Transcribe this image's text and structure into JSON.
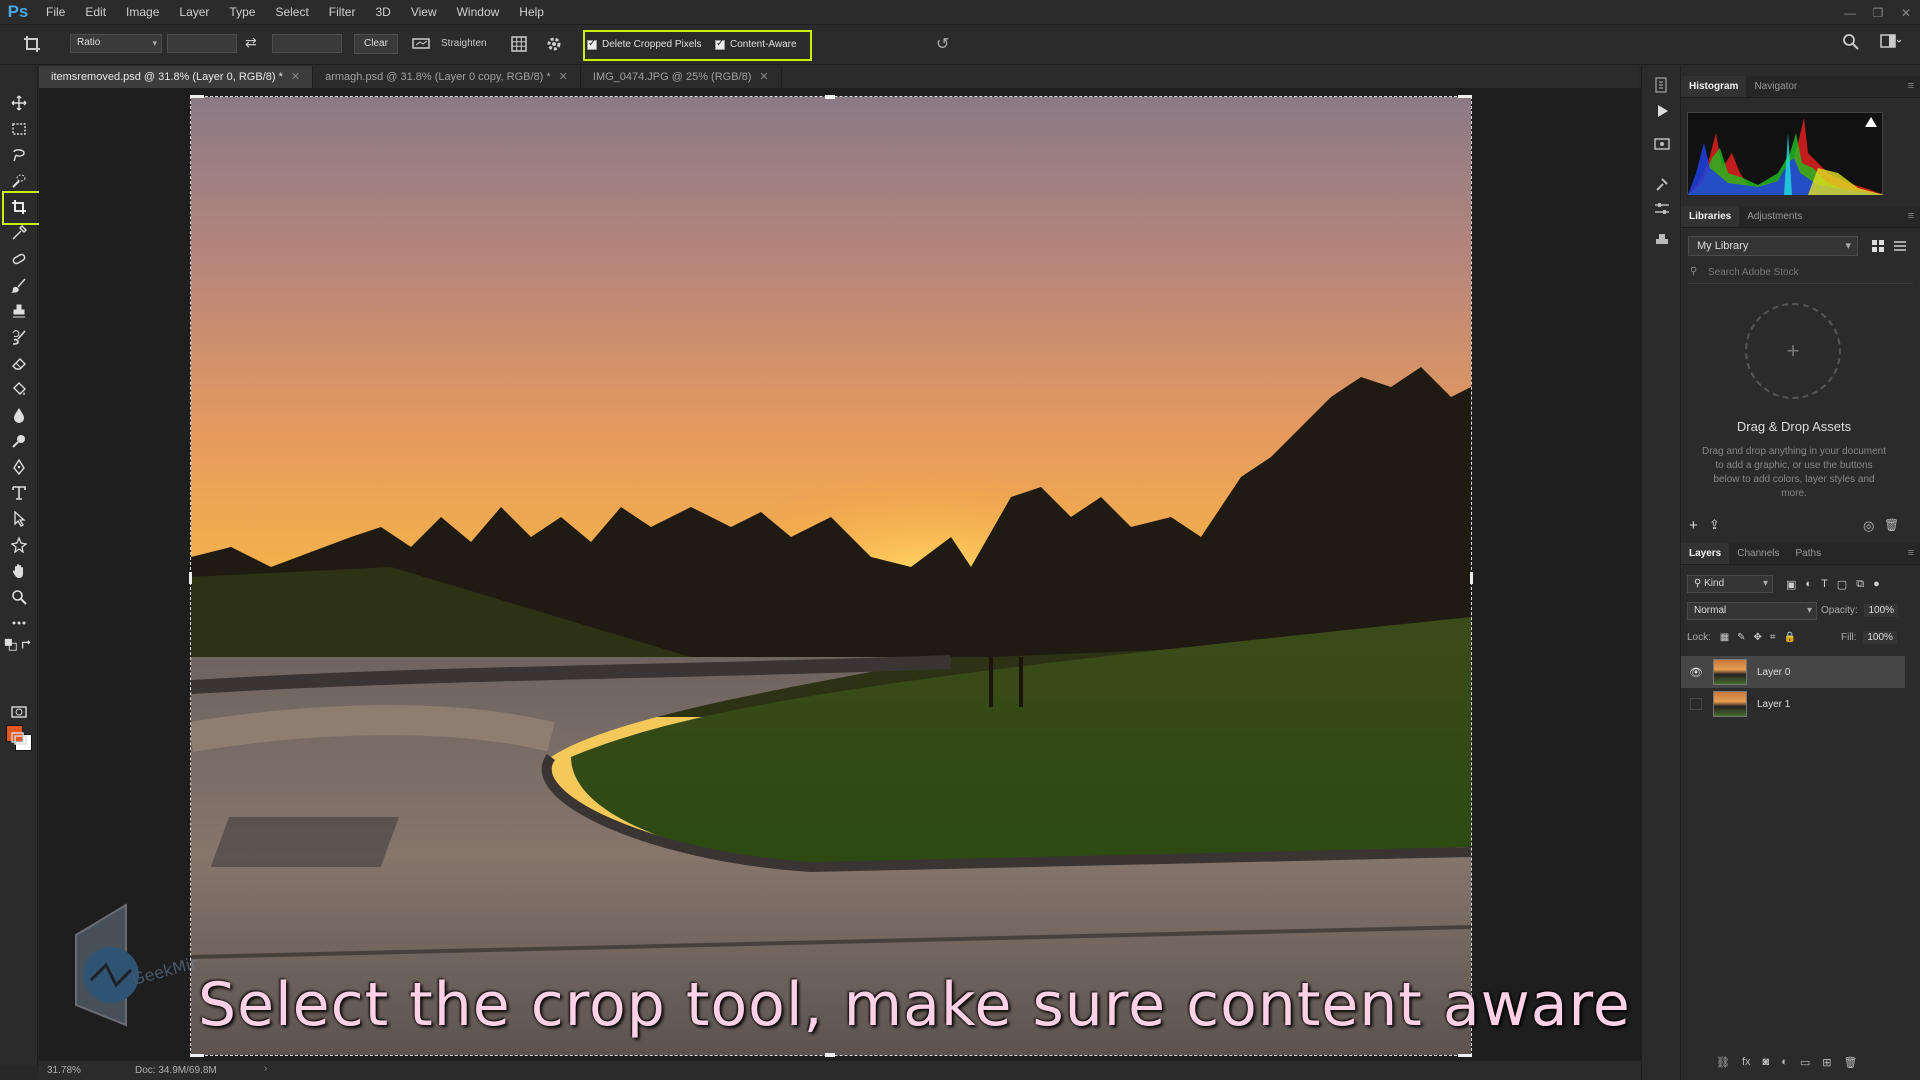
{
  "app": {
    "logo": "Ps"
  },
  "menu": [
    "File",
    "Edit",
    "Image",
    "Layer",
    "Type",
    "Select",
    "Filter",
    "3D",
    "View",
    "Window",
    "Help"
  ],
  "options": {
    "ratio": "Ratio",
    "clear": "Clear",
    "straighten": "Straighten",
    "delete_cropped": "Delete Cropped Pixels",
    "content_aware": "Content-Aware"
  },
  "tabs": [
    {
      "label": "itemsremoved.psd @ 31.8% (Layer 0, RGB/8) *",
      "active": true
    },
    {
      "label": "armagh.psd @ 31.8% (Layer 0 copy, RGB/8) *",
      "active": false
    },
    {
      "label": "IMG_0474.JPG @ 25% (RGB/8)",
      "active": false
    }
  ],
  "status": {
    "zoom": "31.78%",
    "doc": "Doc: 34.9M/69.8M"
  },
  "caption": "Select the crop tool, make sure content aware is selected",
  "watermark": "GeekMinds",
  "panels": {
    "histogram_tabs": [
      "Histogram",
      "Navigator"
    ],
    "library_tabs": [
      "Libraries",
      "Adjustments"
    ],
    "library_name": "My Library",
    "library_search": "Search Adobe Stock",
    "drag_title": "Drag & Drop Assets",
    "drag_text": "Drag and drop anything in your document to add a graphic, or use the buttons below to add colors, layer styles and more.",
    "layer_tabs": [
      "Layers",
      "Channels",
      "Paths"
    ],
    "kind": "Kind",
    "blend_mode": "Normal",
    "opacity_label": "Opacity:",
    "opacity_value": "100%",
    "lock_label": "Lock:",
    "fill_label": "Fill:",
    "fill_value": "100%",
    "layers": [
      {
        "name": "Layer 0",
        "visible": true,
        "selected": true
      },
      {
        "name": "Layer 1",
        "visible": false,
        "selected": false
      }
    ]
  },
  "colors": {
    "foreground": "#e4571f",
    "background": "#ffffff",
    "highlight": "#c8f000"
  }
}
